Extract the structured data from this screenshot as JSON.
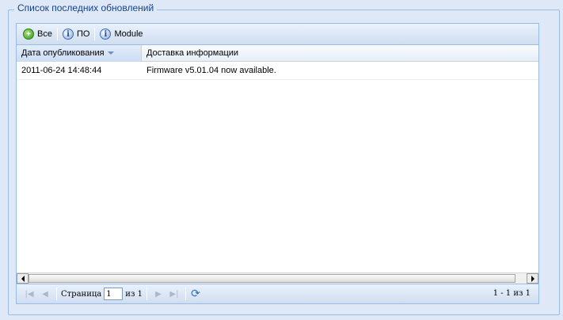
{
  "fieldset": {
    "title": "Список последних обновлений"
  },
  "toolbar": {
    "buttons": [
      {
        "label": "Все",
        "icon": "add-icon"
      },
      {
        "label": "ПО",
        "icon": "info-icon"
      },
      {
        "label": "Module",
        "icon": "info-icon"
      }
    ]
  },
  "grid": {
    "columns": [
      {
        "label": "Дата опубликования",
        "sorted": "desc"
      },
      {
        "label": "Доставка информации"
      }
    ],
    "rows": [
      [
        "2011-06-24 14:48:44",
        "Firmware v5.01.04 now available."
      ]
    ]
  },
  "pager": {
    "page_label": "Страница",
    "page_value": "1",
    "of_label": "из 1",
    "display_info": "1 - 1 из 1"
  },
  "colors": {
    "background": "#dfe8f6",
    "border": "#99bbe8",
    "title_text": "#15428b"
  }
}
